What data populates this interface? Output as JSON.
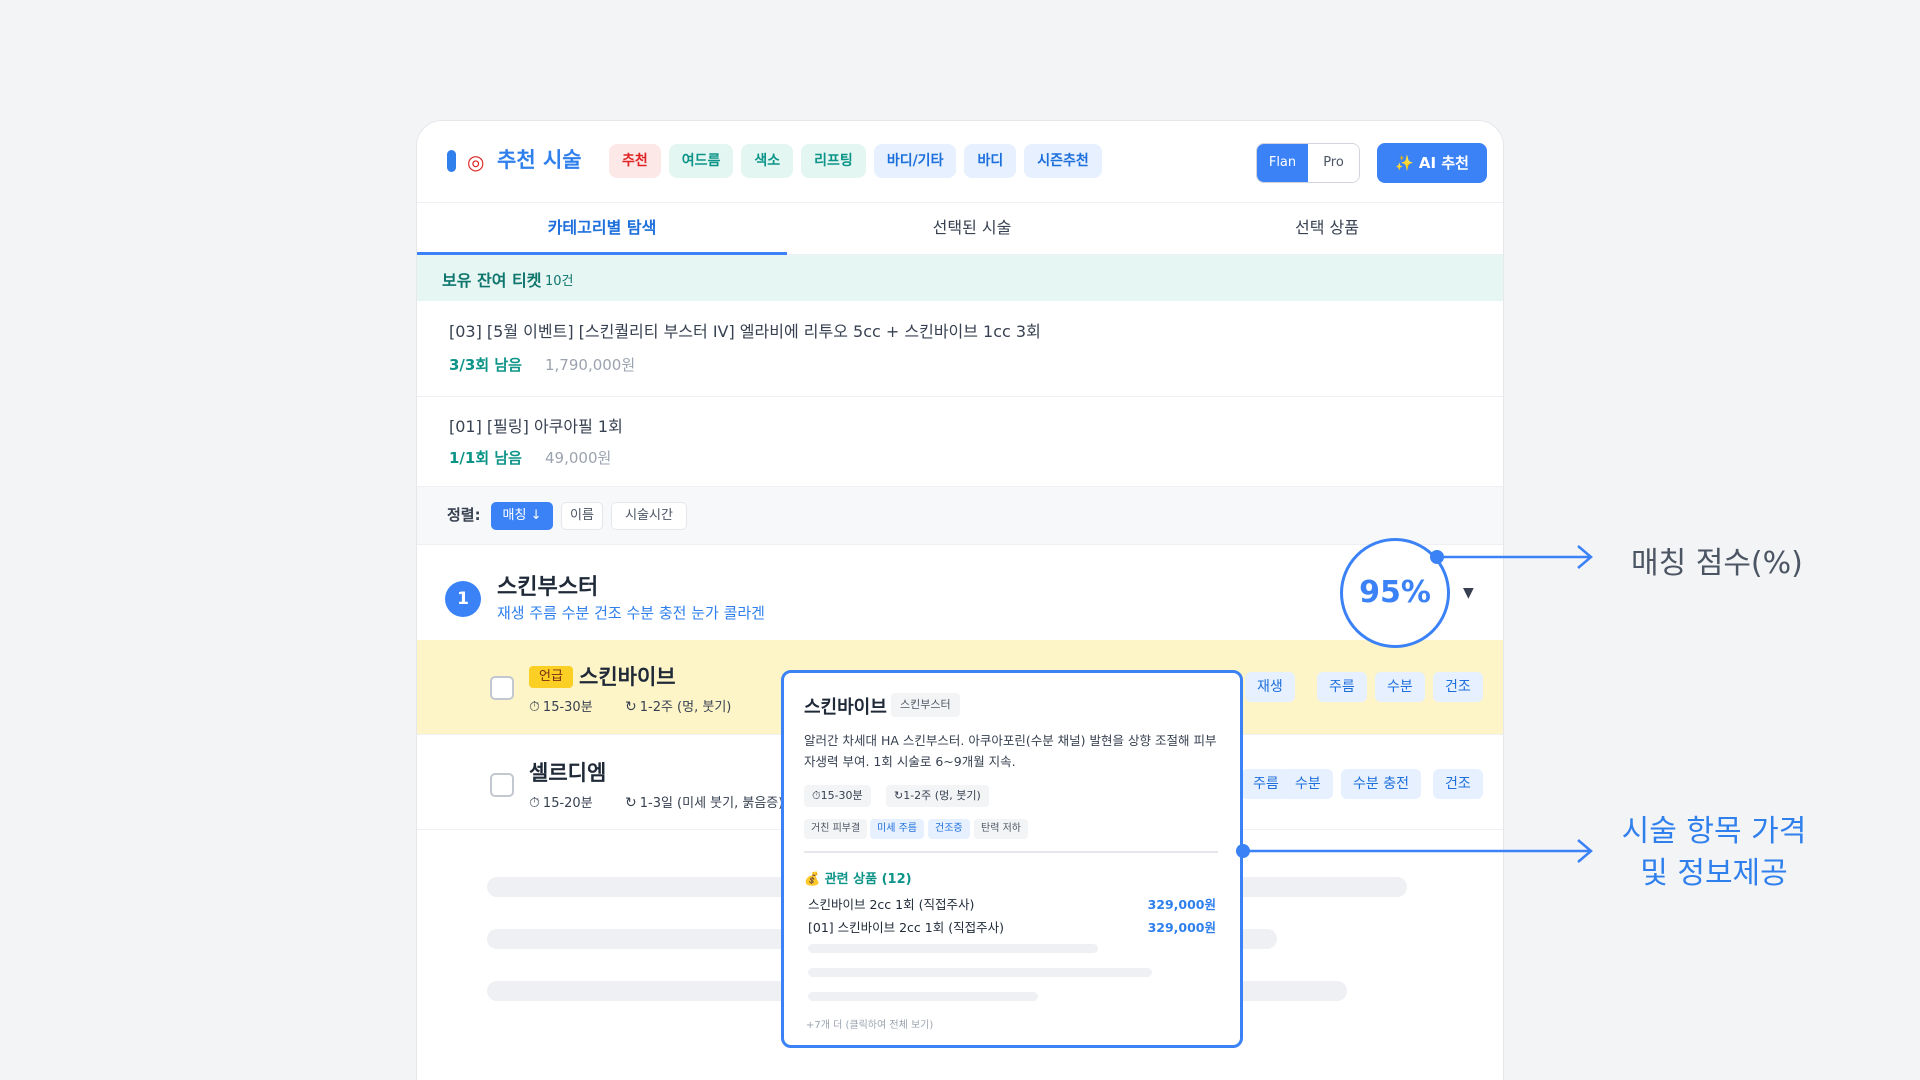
{
  "header": {
    "title_icon": "target-icon",
    "title": "추천 시술",
    "chips": [
      {
        "label": "추천",
        "color": "red"
      },
      {
        "label": "여드름",
        "color": "teal"
      },
      {
        "label": "색소",
        "color": "teal"
      },
      {
        "label": "리프팅",
        "color": "teal"
      },
      {
        "label": "바디/기타",
        "color": "blue"
      },
      {
        "label": "바디",
        "color": "blue"
      },
      {
        "label": "시즌추천",
        "color": "blue"
      }
    ],
    "mode_toggle": {
      "options": [
        "Flan",
        "Pro"
      ],
      "selected": "Flan"
    },
    "ai_button": "✨ AI 추천"
  },
  "tabs": [
    {
      "label": "카테고리별 탐색",
      "active": true
    },
    {
      "label": "선택된 시술",
      "active": false
    },
    {
      "label": "선택 상품",
      "active": false
    }
  ],
  "tickets": {
    "title": "보유 잔여 티켓",
    "count": "10건",
    "items": [
      {
        "name": "[03] [5월 이벤트] [스킨퀄리티 부스터 IV] 엘라비에 리투오 5cc + 스킨바이브 1cc 3회",
        "remaining": "3/3회 남음",
        "price": "1,790,000원"
      },
      {
        "name": "[01] [필링] 아쿠아필 1회",
        "remaining": "1/1회 남음",
        "price": "49,000원"
      }
    ]
  },
  "sort": {
    "label": "정렬:",
    "options": [
      "매칭 ↓",
      "이름",
      "시술시간"
    ],
    "active": "매칭 ↓"
  },
  "category": {
    "number": "1",
    "name": "스킨부스터",
    "tags": "재생 주름 수분 건조 수분 충전 눈가 콜라겐",
    "match_score": "95%",
    "match_percent": 95
  },
  "treatments": [
    {
      "badge": "언급",
      "name": "스킨바이브",
      "duration": "15-30분",
      "downtime": "1-2주 (멍, 붓기)",
      "tags": [
        "재생",
        "주름",
        "수분",
        "건조"
      ],
      "highlighted": true
    },
    {
      "badge": "",
      "name": "셀르디엠",
      "duration": "15-20분",
      "downtime": "1-3일 (미세 붓기, 붉음증)",
      "tags": [
        "주름",
        "수분",
        "수분 충전",
        "건조"
      ],
      "highlighted": false
    }
  ],
  "popup": {
    "title": "스킨바이브",
    "category": "스킨부스터",
    "description": "알러간 차세대 HA 스킨부스터. 아쿠아포린(수분 채널) 발현을 상향 조절해 피부 자생력 부여. 1회 시술로 6~9개월 지속.",
    "duration": "⏱15-30분",
    "downtime": "1-2주 (멍, 붓기)",
    "tags": [
      {
        "label": "거친 피부결",
        "style": "gray"
      },
      {
        "label": "미세 주름",
        "style": "blue"
      },
      {
        "label": "건조증",
        "style": "blue"
      },
      {
        "label": "탄력 저하",
        "style": "gray"
      }
    ],
    "related_title": "💰 관련 상품 (12)",
    "products": [
      {
        "name": "스킨바이브 2cc 1회 (직접주사)",
        "price": "329,000원"
      },
      {
        "name": "[01] 스킨바이브 2cc 1회 (직접주사)",
        "price": "329,000원"
      }
    ],
    "more": "+7개 더 (클릭하여 전체 보기)"
  },
  "annotations": {
    "match_score": "매칭 점수(%)",
    "price_info_line1": "시술 항목 가격",
    "price_info_line2": "및 정보제공"
  },
  "colors": {
    "accent": "#3b82f6",
    "teal": "#0d9488",
    "highlight_row": "#fdf5c8",
    "badge": "#fbcf24"
  }
}
